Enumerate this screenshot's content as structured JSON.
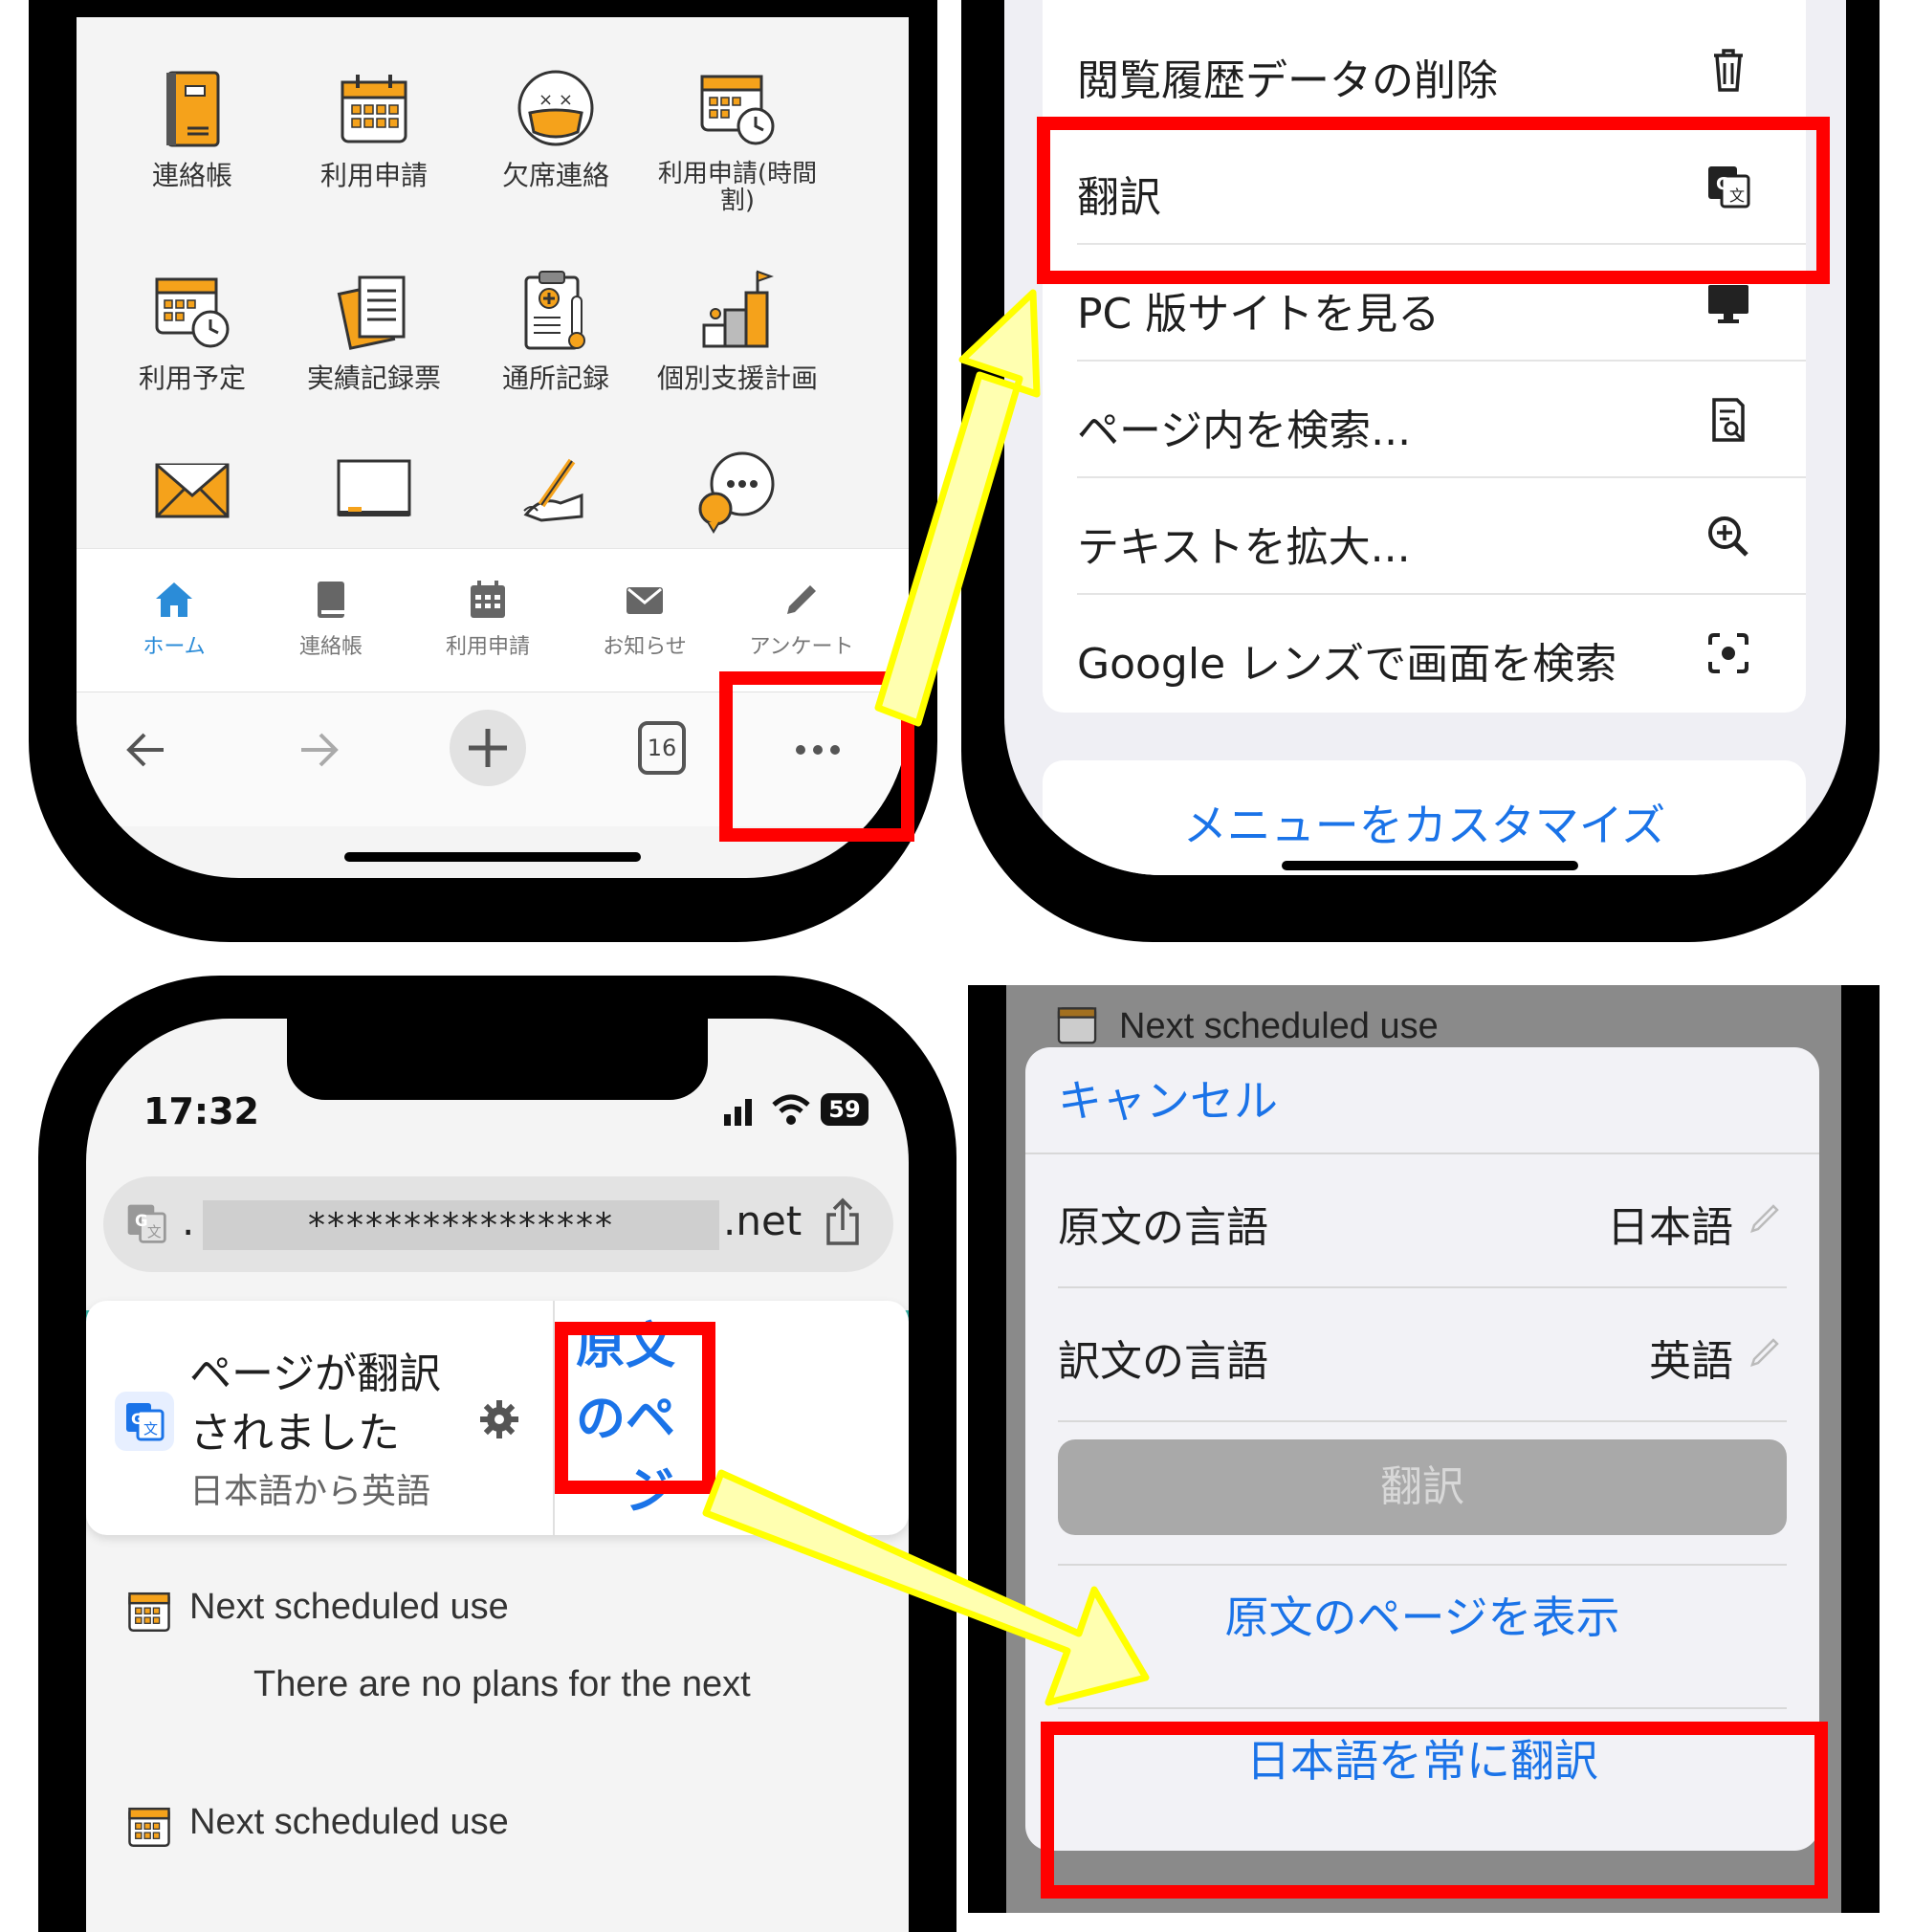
{
  "phone1": {
    "grid": [
      {
        "label": "連絡帳",
        "icon": "notebook-icon"
      },
      {
        "label": "利用申請",
        "icon": "calendar-icon"
      },
      {
        "label": "欠席連絡",
        "icon": "sick-face-icon"
      },
      {
        "label": "利用申請(時間割)",
        "icon": "calendar-clock-icon"
      },
      {
        "label": "利用予定",
        "icon": "calendar-clock-icon"
      },
      {
        "label": "実績記録票",
        "icon": "documents-icon"
      },
      {
        "label": "通所記録",
        "icon": "clipboard-thermometer-icon"
      },
      {
        "label": "個別支援計画",
        "icon": "steps-flag-icon"
      },
      {
        "label": "",
        "icon": "envelope-icon"
      },
      {
        "label": "",
        "icon": "blackboard-icon"
      },
      {
        "label": "",
        "icon": "signing-hand-icon"
      },
      {
        "label": "",
        "icon": "chat-bubble-icon"
      }
    ],
    "tabs": [
      {
        "label": "ホーム",
        "icon": "home-icon"
      },
      {
        "label": "連絡帳",
        "icon": "book-icon"
      },
      {
        "label": "利用申請",
        "icon": "calendar-icon"
      },
      {
        "label": "お知らせ",
        "icon": "mail-icon"
      },
      {
        "label": "アンケート",
        "icon": "pencil-icon"
      }
    ],
    "tab_count": "16"
  },
  "phone2": {
    "menu": [
      {
        "label": "閲覧履歴データの削除",
        "icon": "trash-icon"
      },
      {
        "label": "翻訳",
        "icon": "translate-icon"
      },
      {
        "label": "PC 版サイトを見る",
        "icon": "desktop-icon"
      },
      {
        "label": "ページ内を検索...",
        "icon": "find-in-page-icon"
      },
      {
        "label": "テキストを拡大...",
        "icon": "zoom-in-icon"
      },
      {
        "label": "Google レンズで画面を検索",
        "icon": "lens-icon"
      }
    ],
    "customize": "メニューをカスタマイズ"
  },
  "phone3": {
    "time": "17:32",
    "battery": "59",
    "url_dot": ".",
    "url_mask": "****************",
    "url_tld": ".net",
    "banner_title_1": "ページが翻訳",
    "banner_title_2": "されました",
    "banner_sub": "日本語から英語",
    "banner_action": "原文のページを表示",
    "sched_title": "Next scheduled use",
    "sched_text": "There are no plans for the next"
  },
  "phone4": {
    "header": "Next scheduled use",
    "cancel": "キャンセル",
    "source_label": "原文の言語",
    "source_value": "日本語",
    "target_label": "訳文の言語",
    "target_value": "英語",
    "translate_button": "翻訳",
    "show_original": "原文のページを表示",
    "always_translate": "日本語を常に翻訳"
  },
  "colors": {
    "highlight": "#ff0000",
    "arrow_fill": "#ffffb0",
    "arrow_stroke": "#ffff00",
    "link": "#1a73e8",
    "accent_orange": "#f5a21b"
  }
}
